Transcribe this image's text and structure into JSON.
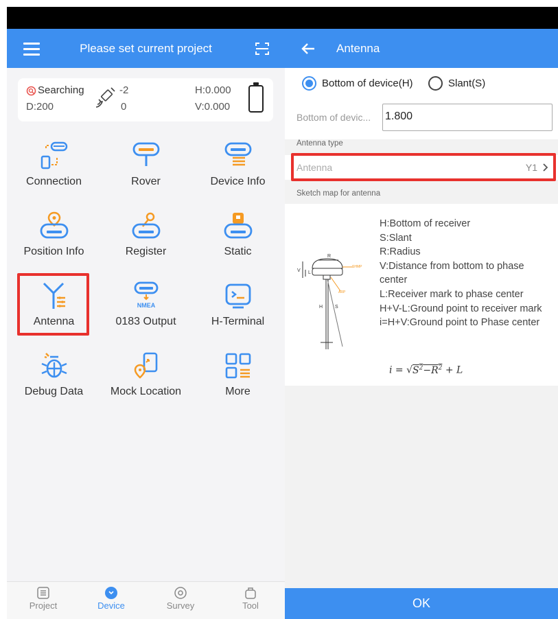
{
  "left": {
    "header": {
      "title": "Please set current project"
    },
    "status": {
      "searching": "Searching",
      "d_value": "D:200",
      "sat_top": "-2",
      "sat_bottom": "0",
      "h_value": "H:0.000",
      "v_value": "V:0.000"
    },
    "grid": [
      {
        "label": "Connection",
        "icon": "connection-icon"
      },
      {
        "label": "Rover",
        "icon": "rover-icon"
      },
      {
        "label": "Device Info",
        "icon": "device-info-icon"
      },
      {
        "label": "Position Info",
        "icon": "position-info-icon"
      },
      {
        "label": "Register",
        "icon": "register-icon"
      },
      {
        "label": "Static",
        "icon": "static-icon"
      },
      {
        "label": "Antenna",
        "icon": "antenna-icon"
      },
      {
        "label": "0183 Output",
        "icon": "nmea-icon"
      },
      {
        "label": "H-Terminal",
        "icon": "terminal-icon"
      },
      {
        "label": "Debug Data",
        "icon": "bug-icon"
      },
      {
        "label": "Mock Location",
        "icon": "mock-location-icon"
      },
      {
        "label": "More",
        "icon": "more-grid-icon"
      }
    ],
    "nmea_badge": "NMEA",
    "bottom_nav": [
      {
        "label": "Project",
        "active": false
      },
      {
        "label": "Device",
        "active": true
      },
      {
        "label": "Survey",
        "active": false
      },
      {
        "label": "Tool",
        "active": false
      }
    ]
  },
  "right": {
    "header": {
      "title": "Antenna"
    },
    "radios": [
      {
        "label": "Bottom of device(H)",
        "checked": true
      },
      {
        "label": "Slant(S)",
        "checked": false
      }
    ],
    "height_field": {
      "label": "Bottom of devic...",
      "value": "1.800"
    },
    "antenna_type_caption": "Antenna type",
    "antenna_row": {
      "label": "Antenna",
      "value": "Y1"
    },
    "sketch_caption": "Sketch map for antenna",
    "sketch_lines": [
      "H:Bottom of receiver",
      "S:Slant",
      "R:Radius",
      "V:Distance from bottom to phase center",
      "L:Receiver mark to phase center",
      "H+V-L:Ground point to receiver mark",
      "i=H+V:Ground point to Phase center"
    ],
    "diagram_labels": {
      "r": "R",
      "h": "H",
      "s": "S",
      "v": "V",
      "l": "L",
      "shmp": "SHMP",
      "arp": "ARP"
    },
    "ok_label": "OK"
  },
  "colors": {
    "accent": "#3d8ff0",
    "orange": "#f59a23",
    "highlight": "#e8312d"
  }
}
